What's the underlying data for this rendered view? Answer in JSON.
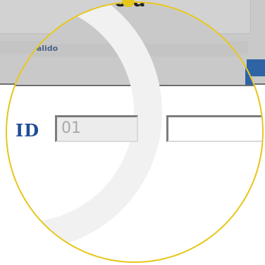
{
  "background": {
    "hint_text": "sarà valido",
    "heading_fragment": "o a"
  },
  "form": {
    "id_label": "ID",
    "id_value": "01",
    "name_value": ""
  },
  "colors": {
    "lens_border": "#e6c619",
    "label_blue": "#1f4e96",
    "accent_blue": "#2e63a6"
  }
}
